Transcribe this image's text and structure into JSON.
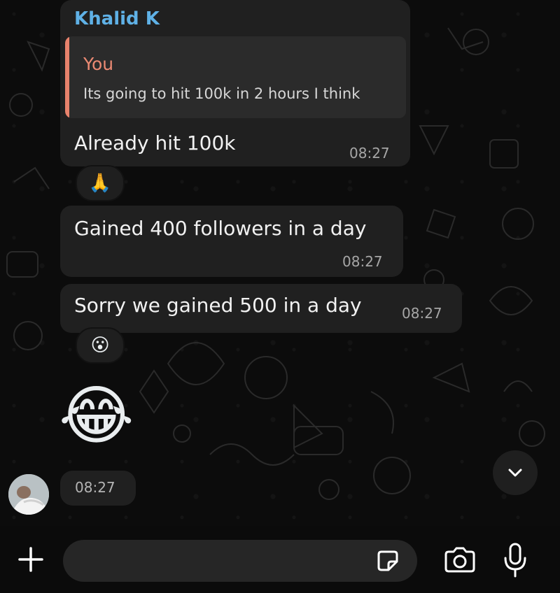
{
  "colors": {
    "chat_background": "#0c0c0c",
    "bubble": "#202020",
    "sender_name": "#5fb1e6",
    "quote_accent": "#e8826c",
    "timestamp": "#a6a6a6"
  },
  "messages": [
    {
      "sender": "Khalid K",
      "reply_to": {
        "author": "You",
        "text": "Its going to hit 100k in 2 hours I think"
      },
      "text": "Already hit 100k",
      "time": "08:27",
      "reaction": "🙏"
    },
    {
      "text": "Gained 400 followers in a day",
      "time": "08:27"
    },
    {
      "text": "Sorry we gained 500 in a day",
      "time": "08:27",
      "reaction": "😮"
    },
    {
      "emoji": "😂",
      "time": "08:27"
    }
  ],
  "icons": {
    "scroll_down": "chevron-down-icon",
    "attach": "plus-icon",
    "sticker": "sticker-icon",
    "camera": "camera-icon",
    "mic": "microphone-icon"
  },
  "composer": {
    "value": "",
    "placeholder": ""
  }
}
